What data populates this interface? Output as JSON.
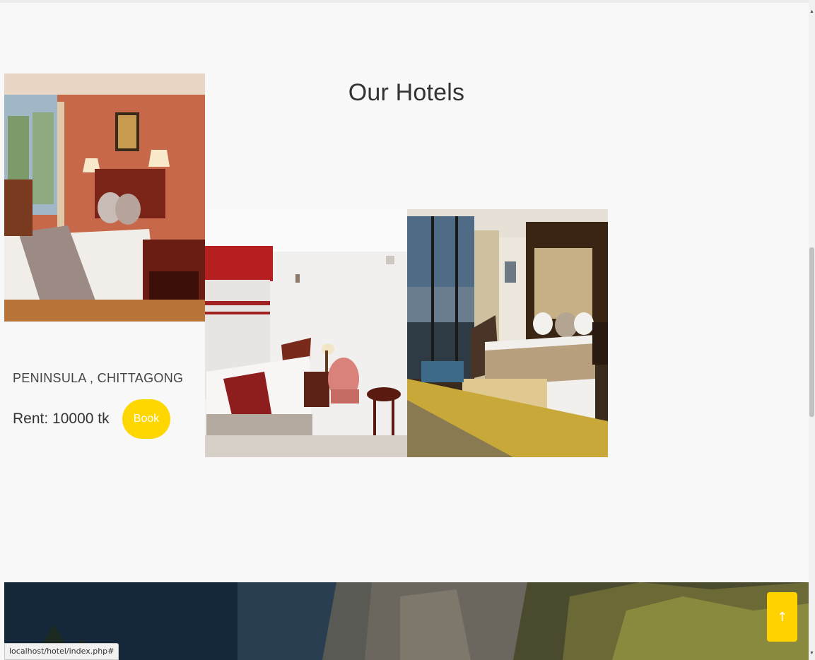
{
  "section": {
    "title": "Our Hotels"
  },
  "hotels": [
    {
      "name": "PENINSULA , CHITTAGONG",
      "rent": "Rent: 10000 tk",
      "book_label": "Book"
    }
  ],
  "back_to_top": {
    "icon": "arrow-up-icon",
    "glyph": "↑"
  },
  "status_bar": {
    "url": "localhost/hotel/index.php#"
  },
  "scrollbar": {
    "up_glyph": "▲",
    "down_glyph": "▼"
  },
  "colors": {
    "accent": "#ffd700",
    "background": "#f8f8f8",
    "text": "#333333"
  }
}
